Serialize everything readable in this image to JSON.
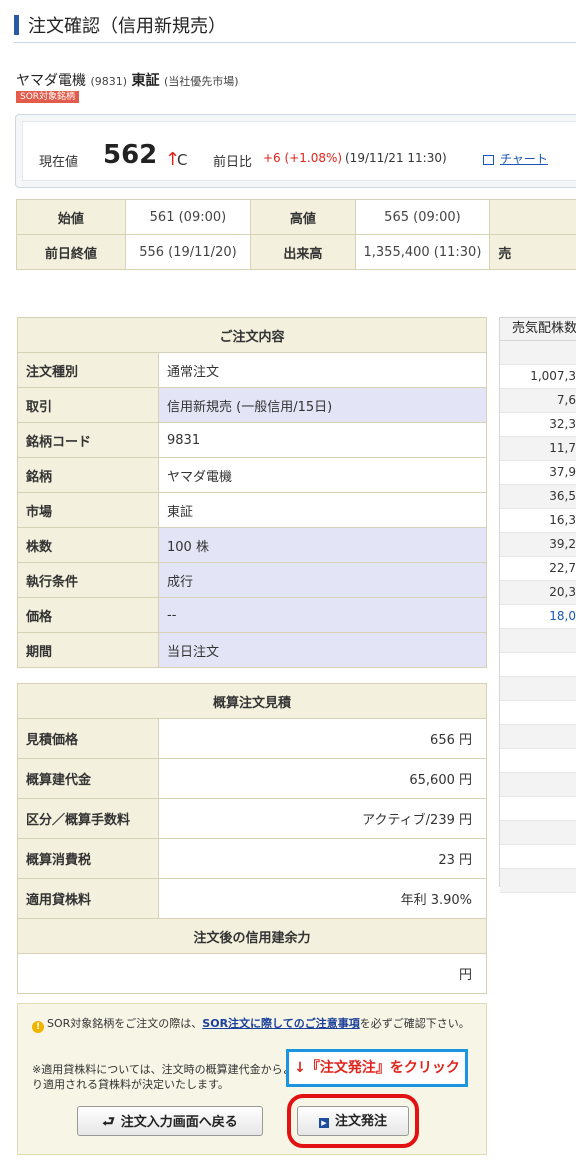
{
  "page_title": "注文確認（信用新規売）",
  "stock": {
    "name": "ヤマダ電機",
    "code": "(9831)",
    "market": "東証",
    "market_note": "(当社優先市場)",
    "sor_badge": "SOR対象銘柄"
  },
  "price": {
    "label": "現在値",
    "value": "562",
    "arrow": "↑",
    "flag": "C",
    "diff_label": "前日比",
    "diff": "+6 (+1.08%)",
    "time": "(19/11/21 11:30)",
    "chart_link": "チャート"
  },
  "quote": {
    "r1": {
      "h1": "始値",
      "v1": "561 (09:00)",
      "h2": "高値",
      "v2": "565 (09:00)"
    },
    "r2": {
      "h1": "前日終値",
      "v1": "556 (19/11/20)",
      "h2": "出来高",
      "v2": "1,355,400 (11:30)",
      "h3": "売"
    }
  },
  "order": {
    "caption": "ご注文内容",
    "rows": [
      {
        "k": "注文種別",
        "v": "通常注文"
      },
      {
        "k": "取引",
        "v": "信用新規売 (一般信用/15日)"
      },
      {
        "k": "銘柄コード",
        "v": "9831"
      },
      {
        "k": "銘柄",
        "v": "ヤマダ電機"
      },
      {
        "k": "市場",
        "v": "東証"
      },
      {
        "k": "株数",
        "v": "100 株"
      },
      {
        "k": "執行条件",
        "v": "成行"
      },
      {
        "k": "価格",
        "v": "--"
      },
      {
        "k": "期間",
        "v": "当日注文"
      }
    ]
  },
  "estimate": {
    "caption": "概算注文見積",
    "rows": [
      {
        "k": "見積価格",
        "v": "656 円"
      },
      {
        "k": "概算建代金",
        "v": "65,600 円"
      },
      {
        "k": "区分／概算手数料",
        "v": "アクティブ/239 円"
      },
      {
        "k": "概算消費税",
        "v": "23 円"
      },
      {
        "k": "適用貸株料",
        "v": "年利 3.90%"
      }
    ],
    "margin_caption": "注文後の信用建余力",
    "margin_value": "円"
  },
  "notice": {
    "line1_pre": "SOR対象銘柄をご注文の際は、",
    "line1_link": "SOR注文に際してのご注意事項",
    "line1_post": "を必ずご確認下さい。",
    "line2": "※適用貸株料については、注文時の概算建代金からより適用される貸株料が決定いたします。"
  },
  "callout": "↓『注文発注』をクリック",
  "buttons": {
    "back": "注文入力画面へ戻る",
    "order": "注文発注"
  },
  "right_panel": {
    "header": "売気配株数",
    "values": [
      "",
      "1,007,3",
      "7,6",
      "32,3",
      "11,7",
      "37,9",
      "36,5",
      "16,3",
      "39,2",
      "22,7",
      "20,3",
      "18,0",
      "",
      "",
      "",
      "",
      "",
      "",
      "",
      "",
      "",
      "",
      ""
    ]
  },
  "colors": {
    "accent_blue": "#2a5aa6",
    "up_red": "#e0231b",
    "callout_border": "#1a96e0",
    "highlight_ring": "#e31212"
  }
}
